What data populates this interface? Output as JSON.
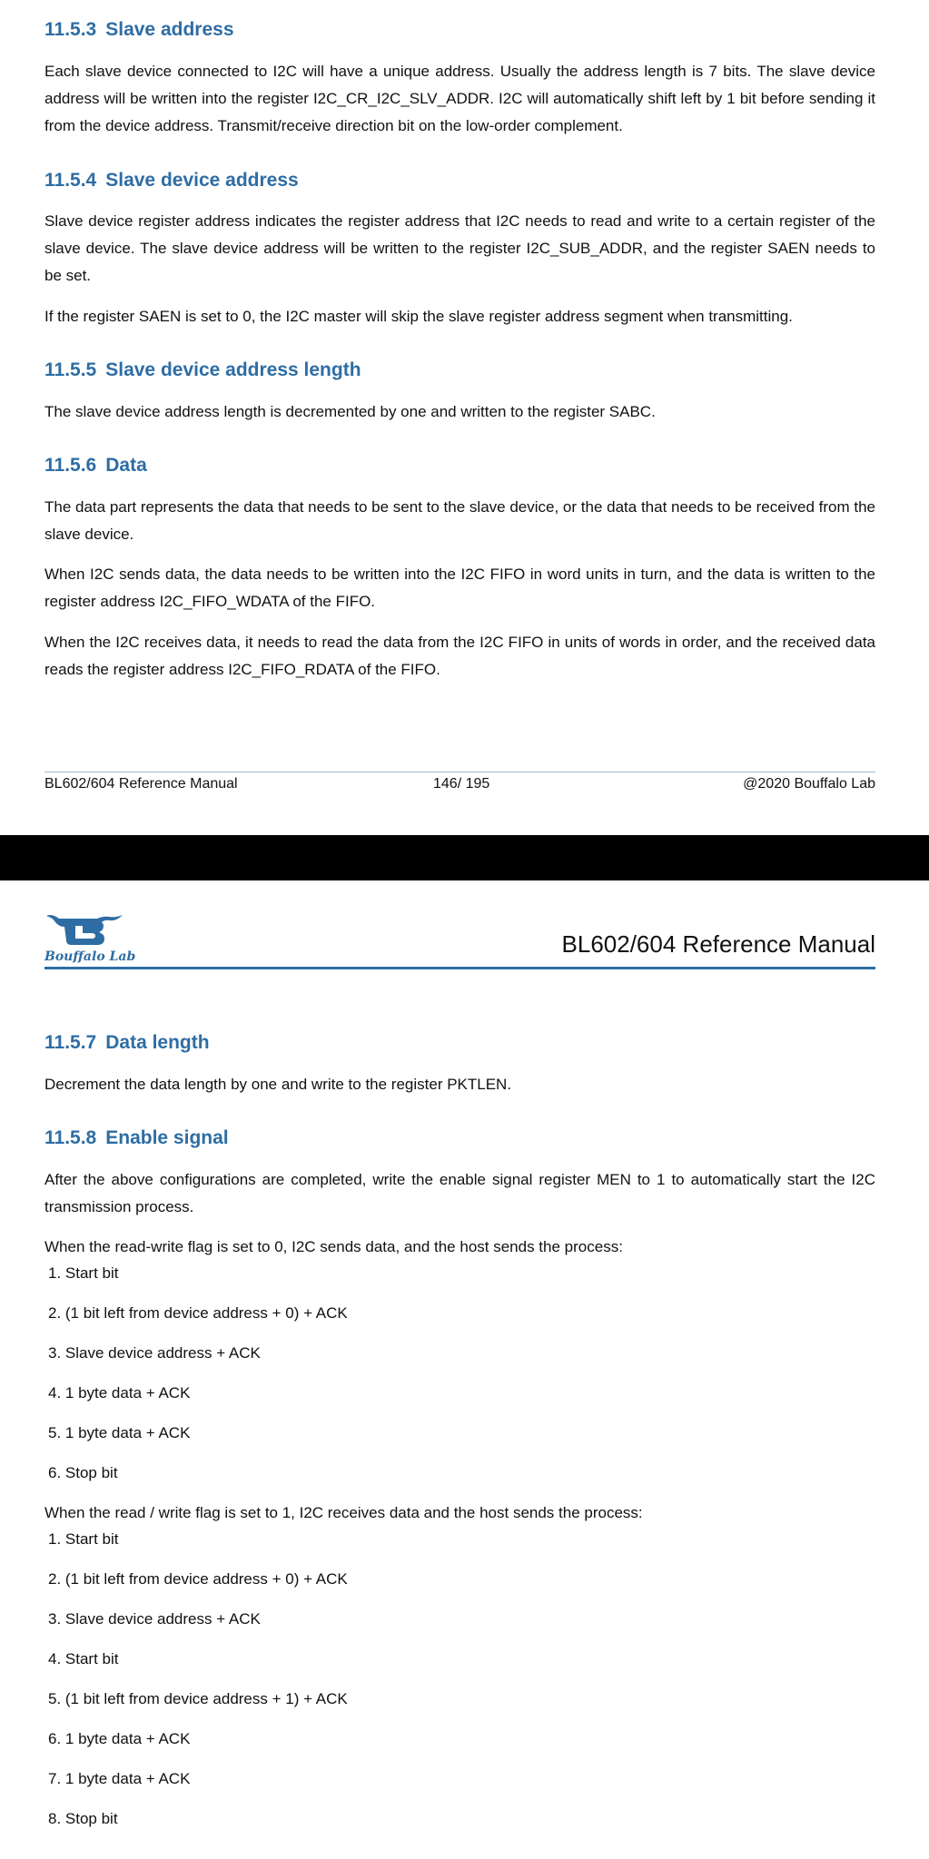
{
  "page1": {
    "sections": [
      {
        "num": "11.5.3",
        "title": "Slave address",
        "paragraphs": [
          "Each slave device connected to I2C will have a unique address. Usually the address length is 7 bits. The slave device address will be written into the register I2C_CR_I2C_SLV_ADDR. I2C will automatically shift left by 1 bit before sending it from the device address. Transmit/receive direction bit on the low-order complement."
        ]
      },
      {
        "num": "11.5.4",
        "title": "Slave device address",
        "paragraphs": [
          "Slave device register address indicates the register address that I2C needs to read and write to a certain register of the slave device. The slave device address will be written to the register I2C_SUB_ADDR, and the register SAEN needs to be set.",
          "If the register SAEN is set to 0, the I2C master will skip the slave register address segment when transmitting."
        ]
      },
      {
        "num": "11.5.5",
        "title": "Slave device address length",
        "paragraphs": [
          "The slave device address length is decremented by one and written to the register SABC."
        ]
      },
      {
        "num": "11.5.6",
        "title": "Data",
        "paragraphs": [
          "The data part represents the data that needs to be sent to the slave device, or the data that needs to be received from the slave device.",
          "When I2C sends data, the data needs to be written into the I2C FIFO in word units in turn, and the data is written to the register address I2C_FIFO_WDATA of the FIFO.",
          "When the I2C receives data, it needs to read the data from the I2C FIFO in units of words in order, and the received data reads the register address I2C_FIFO_RDATA of the FIFO."
        ]
      }
    ],
    "footer": {
      "left": "BL602/604 Reference Manual",
      "center": "146/ 195",
      "right": "@2020 Bouffalo Lab"
    }
  },
  "page2": {
    "header": {
      "logo_text": "Bouffalo Lab",
      "title": "BL602/604 Reference Manual"
    },
    "sec_data_length": {
      "num": "11.5.7",
      "title": "Data length",
      "text": "Decrement the data length by one and write to the register PKTLEN."
    },
    "sec_enable": {
      "num": "11.5.8",
      "title": "Enable signal",
      "intro": "After the above configurations are completed, write the enable signal register MEN to 1 to automatically start the I2C transmission process.",
      "send_intro": "When the read-write flag is set to 0, I2C sends data, and the host sends the process:",
      "send_steps": [
        "1. Start bit",
        "2. (1 bit left from device address + 0) + ACK",
        "3. Slave device address + ACK",
        "4. 1 byte data + ACK",
        "5. 1 byte data + ACK",
        "6. Stop bit"
      ],
      "recv_intro": "When the read / write flag is set to 1, I2C receives data and the host sends the process:",
      "recv_steps": [
        "1. Start bit",
        "2. (1 bit left from device address + 0) + ACK",
        "3. Slave device address + ACK",
        "4. Start bit",
        "5. (1 bit left from device address + 1) + ACK",
        "6. 1 byte data + ACK",
        "7. 1 byte data + ACK",
        "8. Stop bit"
      ]
    }
  }
}
